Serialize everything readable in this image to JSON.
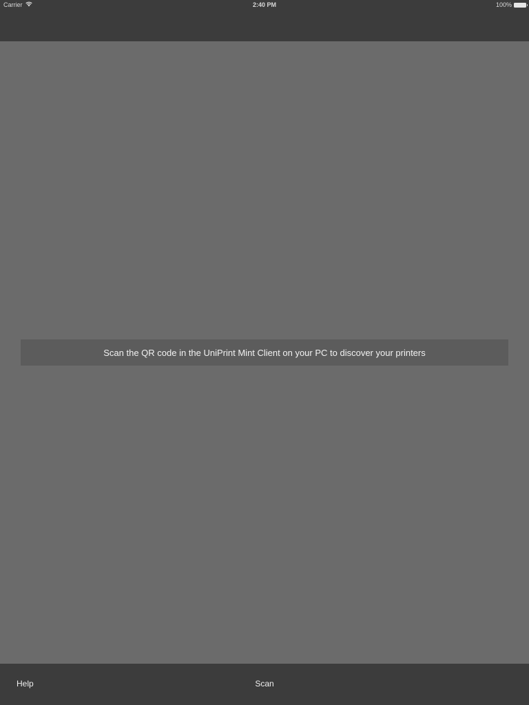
{
  "status_bar": {
    "carrier": "Carrier",
    "wifi_icon": "wifi-icon",
    "time": "2:40 PM",
    "battery_percent": "100%",
    "battery_icon": "battery-icon"
  },
  "main": {
    "banner_text": "Scan the QR code in the UniPrint Mint Client on your PC to discover your printers"
  },
  "toolbar": {
    "help_label": "Help",
    "scan_label": "Scan"
  },
  "colors": {
    "chrome": "#3c3c3c",
    "content": "#6b6b6b",
    "banner": "#5c5c5c"
  }
}
